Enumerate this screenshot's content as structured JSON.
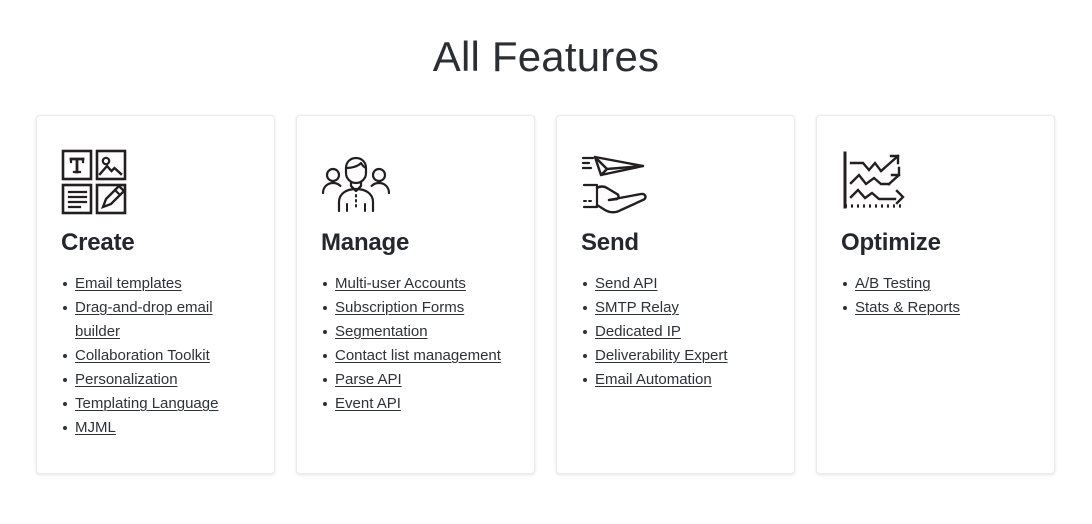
{
  "header": {
    "title": "All Features"
  },
  "cards": [
    {
      "icon": "create-grid-icon",
      "title": "Create",
      "items": [
        "Email templates",
        "Drag-and-drop email builder",
        "Collaboration Toolkit",
        "Personalization",
        "Templating Language",
        "MJML"
      ]
    },
    {
      "icon": "users-group-icon",
      "title": "Manage",
      "items": [
        "Multi-user Accounts",
        "Subscription Forms",
        "Segmentation",
        "Contact list management",
        "Parse API",
        "Event API"
      ]
    },
    {
      "icon": "paper-plane-hand-icon",
      "title": "Send",
      "items": [
        "Send API",
        "SMTP Relay",
        "Dedicated IP",
        "Deliverability Expert",
        "Email Automation"
      ]
    },
    {
      "icon": "trend-chart-icon",
      "title": "Optimize",
      "items": [
        "A/B Testing",
        "Stats & Reports"
      ]
    }
  ],
  "colors": {
    "page_background": "#ffffff",
    "title_text": "#2b2f33",
    "card_title_text": "#24282d",
    "link_text": "#2d3236",
    "card_border": "#ececec",
    "icon_stroke": "#231f20"
  }
}
